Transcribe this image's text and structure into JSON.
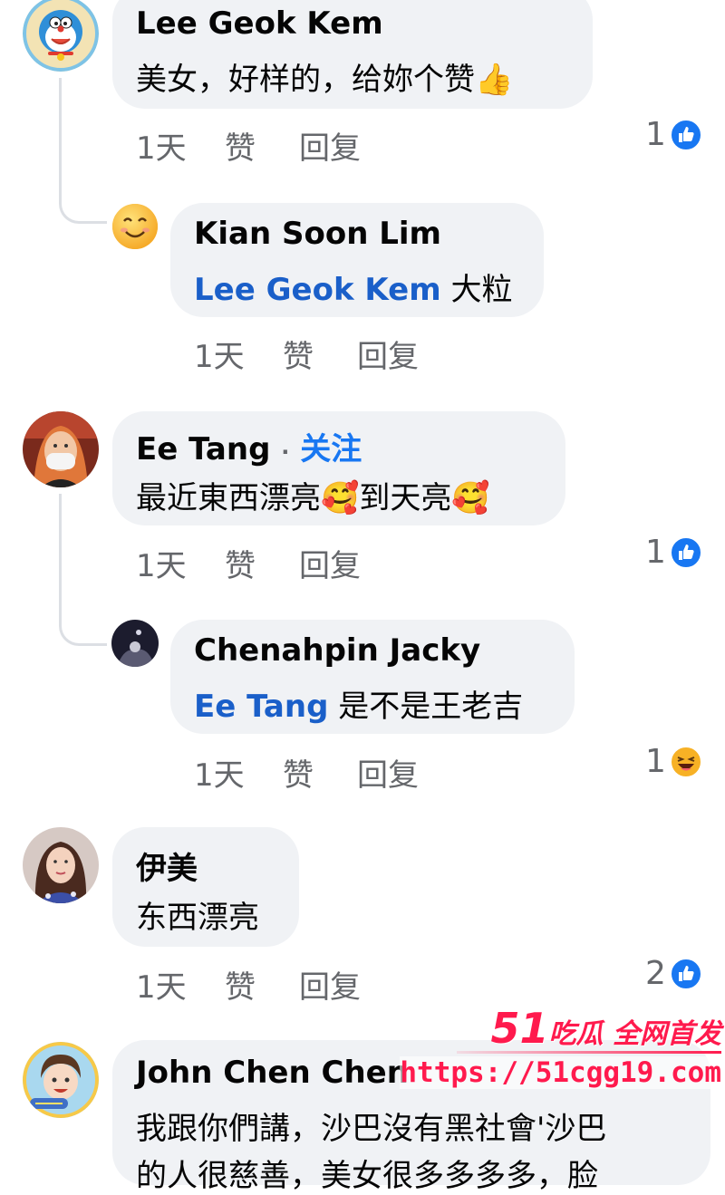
{
  "comments": [
    {
      "author": "Lee Geok Kem",
      "text": "美女，好样的，给妳个赞👍",
      "time": "1天",
      "like": "赞",
      "reply": "回复",
      "reaction_count": "1",
      "reaction_icon": "like-icon",
      "avatar_icon": "doraemon-avatar-icon"
    },
    {
      "author": "Kian Soon Lim",
      "mention": "Lee Geok Kem",
      "text": "大粒",
      "time": "1天",
      "like": "赞",
      "reply": "回复",
      "avatar_icon": "smiley-avatar-icon"
    },
    {
      "author": "Ee Tang",
      "follow_sep": "·",
      "follow": "关注",
      "text": "最近東西漂亮🥰到天亮🥰",
      "time": "1天",
      "like": "赞",
      "reply": "回复",
      "reaction_count": "1",
      "reaction_icon": "like-icon",
      "avatar_icon": "person-photo-avatar-icon"
    },
    {
      "author": "Chenahpin Jacky",
      "mention": "Ee Tang",
      "text": "是不是王老吉",
      "time": "1天",
      "like": "赞",
      "reply": "回复",
      "reaction_count": "1",
      "reaction_icon": "haha-icon",
      "avatar_icon": "night-photo-avatar-icon"
    },
    {
      "author": "伊美",
      "text": "东西漂亮",
      "time": "1天",
      "like": "赞",
      "reply": "回复",
      "reaction_count": "2",
      "reaction_icon": "like-icon",
      "avatar_icon": "woman-photo-avatar-icon"
    },
    {
      "author": "John Chen Chen",
      "text_line1": "我跟你們講，沙巴沒有黑社會'沙巴",
      "text_line2": "的人很慈善，美女很多多多多，脸",
      "avatar_icon": "child-photo-avatar-icon"
    }
  ],
  "watermark": {
    "number": "51",
    "tagline": "吃瓜 全网首发",
    "url": "https://51cgg19.com"
  },
  "colors": {
    "bubble": "#f0f2f5",
    "mention": "#1a5fc9",
    "follow": "#1877f2",
    "meta": "#65676b",
    "like_blue": "#1877f2",
    "watermark": "#ff1a4d"
  }
}
